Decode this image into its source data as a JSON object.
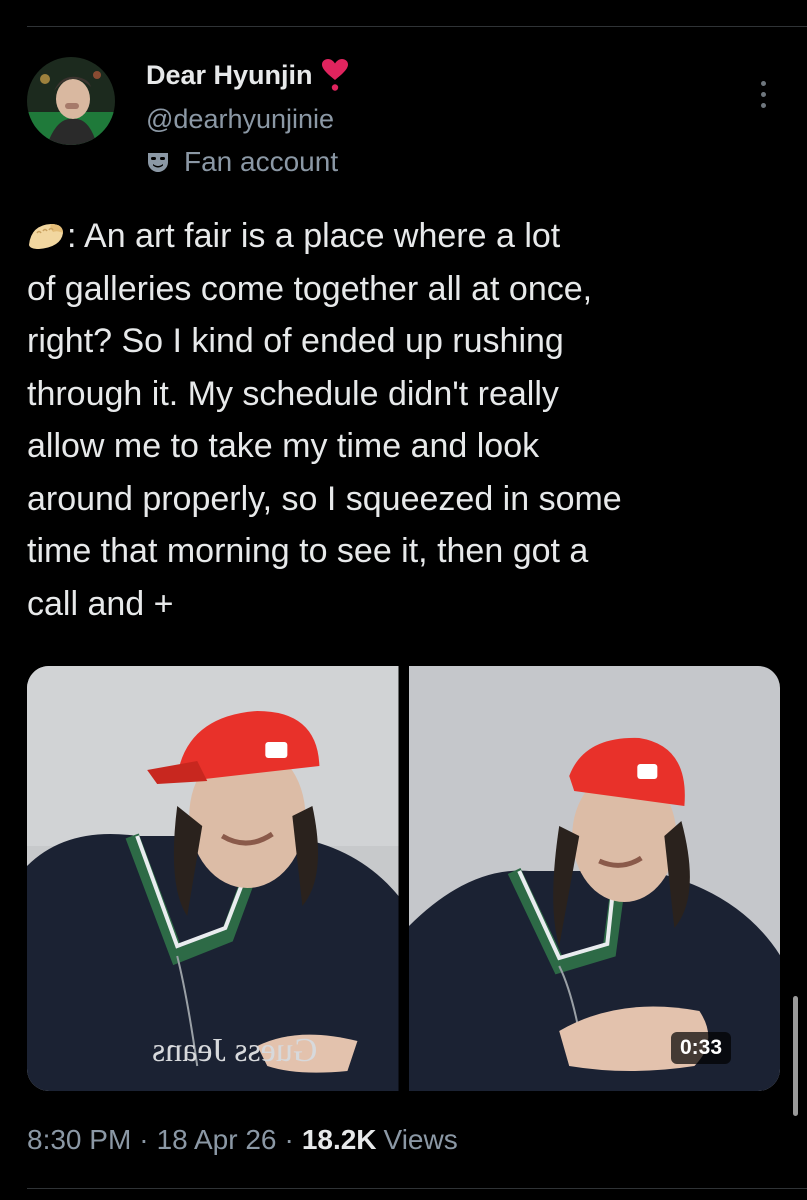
{
  "author": {
    "name": "Dear Hyunjin",
    "handle": "@dearhyunjinie",
    "label": "Fan account"
  },
  "tweet": {
    "text_lines": [
      ": An art fair is a place where a lot",
      "of galleries come together all at once,",
      "right? So I kind of ended up rushing",
      "through it. My schedule didn't really",
      "allow me to take my time and look",
      "around properly, so I squeezed in some",
      "time that morning to see it, then got a",
      "call and +"
    ],
    "emoji_icon": "dumpling-icon"
  },
  "media": {
    "video_duration": "0:33"
  },
  "meta": {
    "time": "8:30 PM",
    "date": "18 Apr 26",
    "separator": "·",
    "views_count": "18.2K",
    "views_label": "Views"
  },
  "icons": {
    "verified_heart": "heart-exclamation-icon",
    "label_icon": "mask-icon",
    "more": "more-vertical-icon"
  },
  "colors": {
    "background": "#000000",
    "primary_text": "#e7e9ea",
    "secondary_text": "#8b98a5",
    "heart": "#e0245e",
    "cap": "#e8312a"
  }
}
